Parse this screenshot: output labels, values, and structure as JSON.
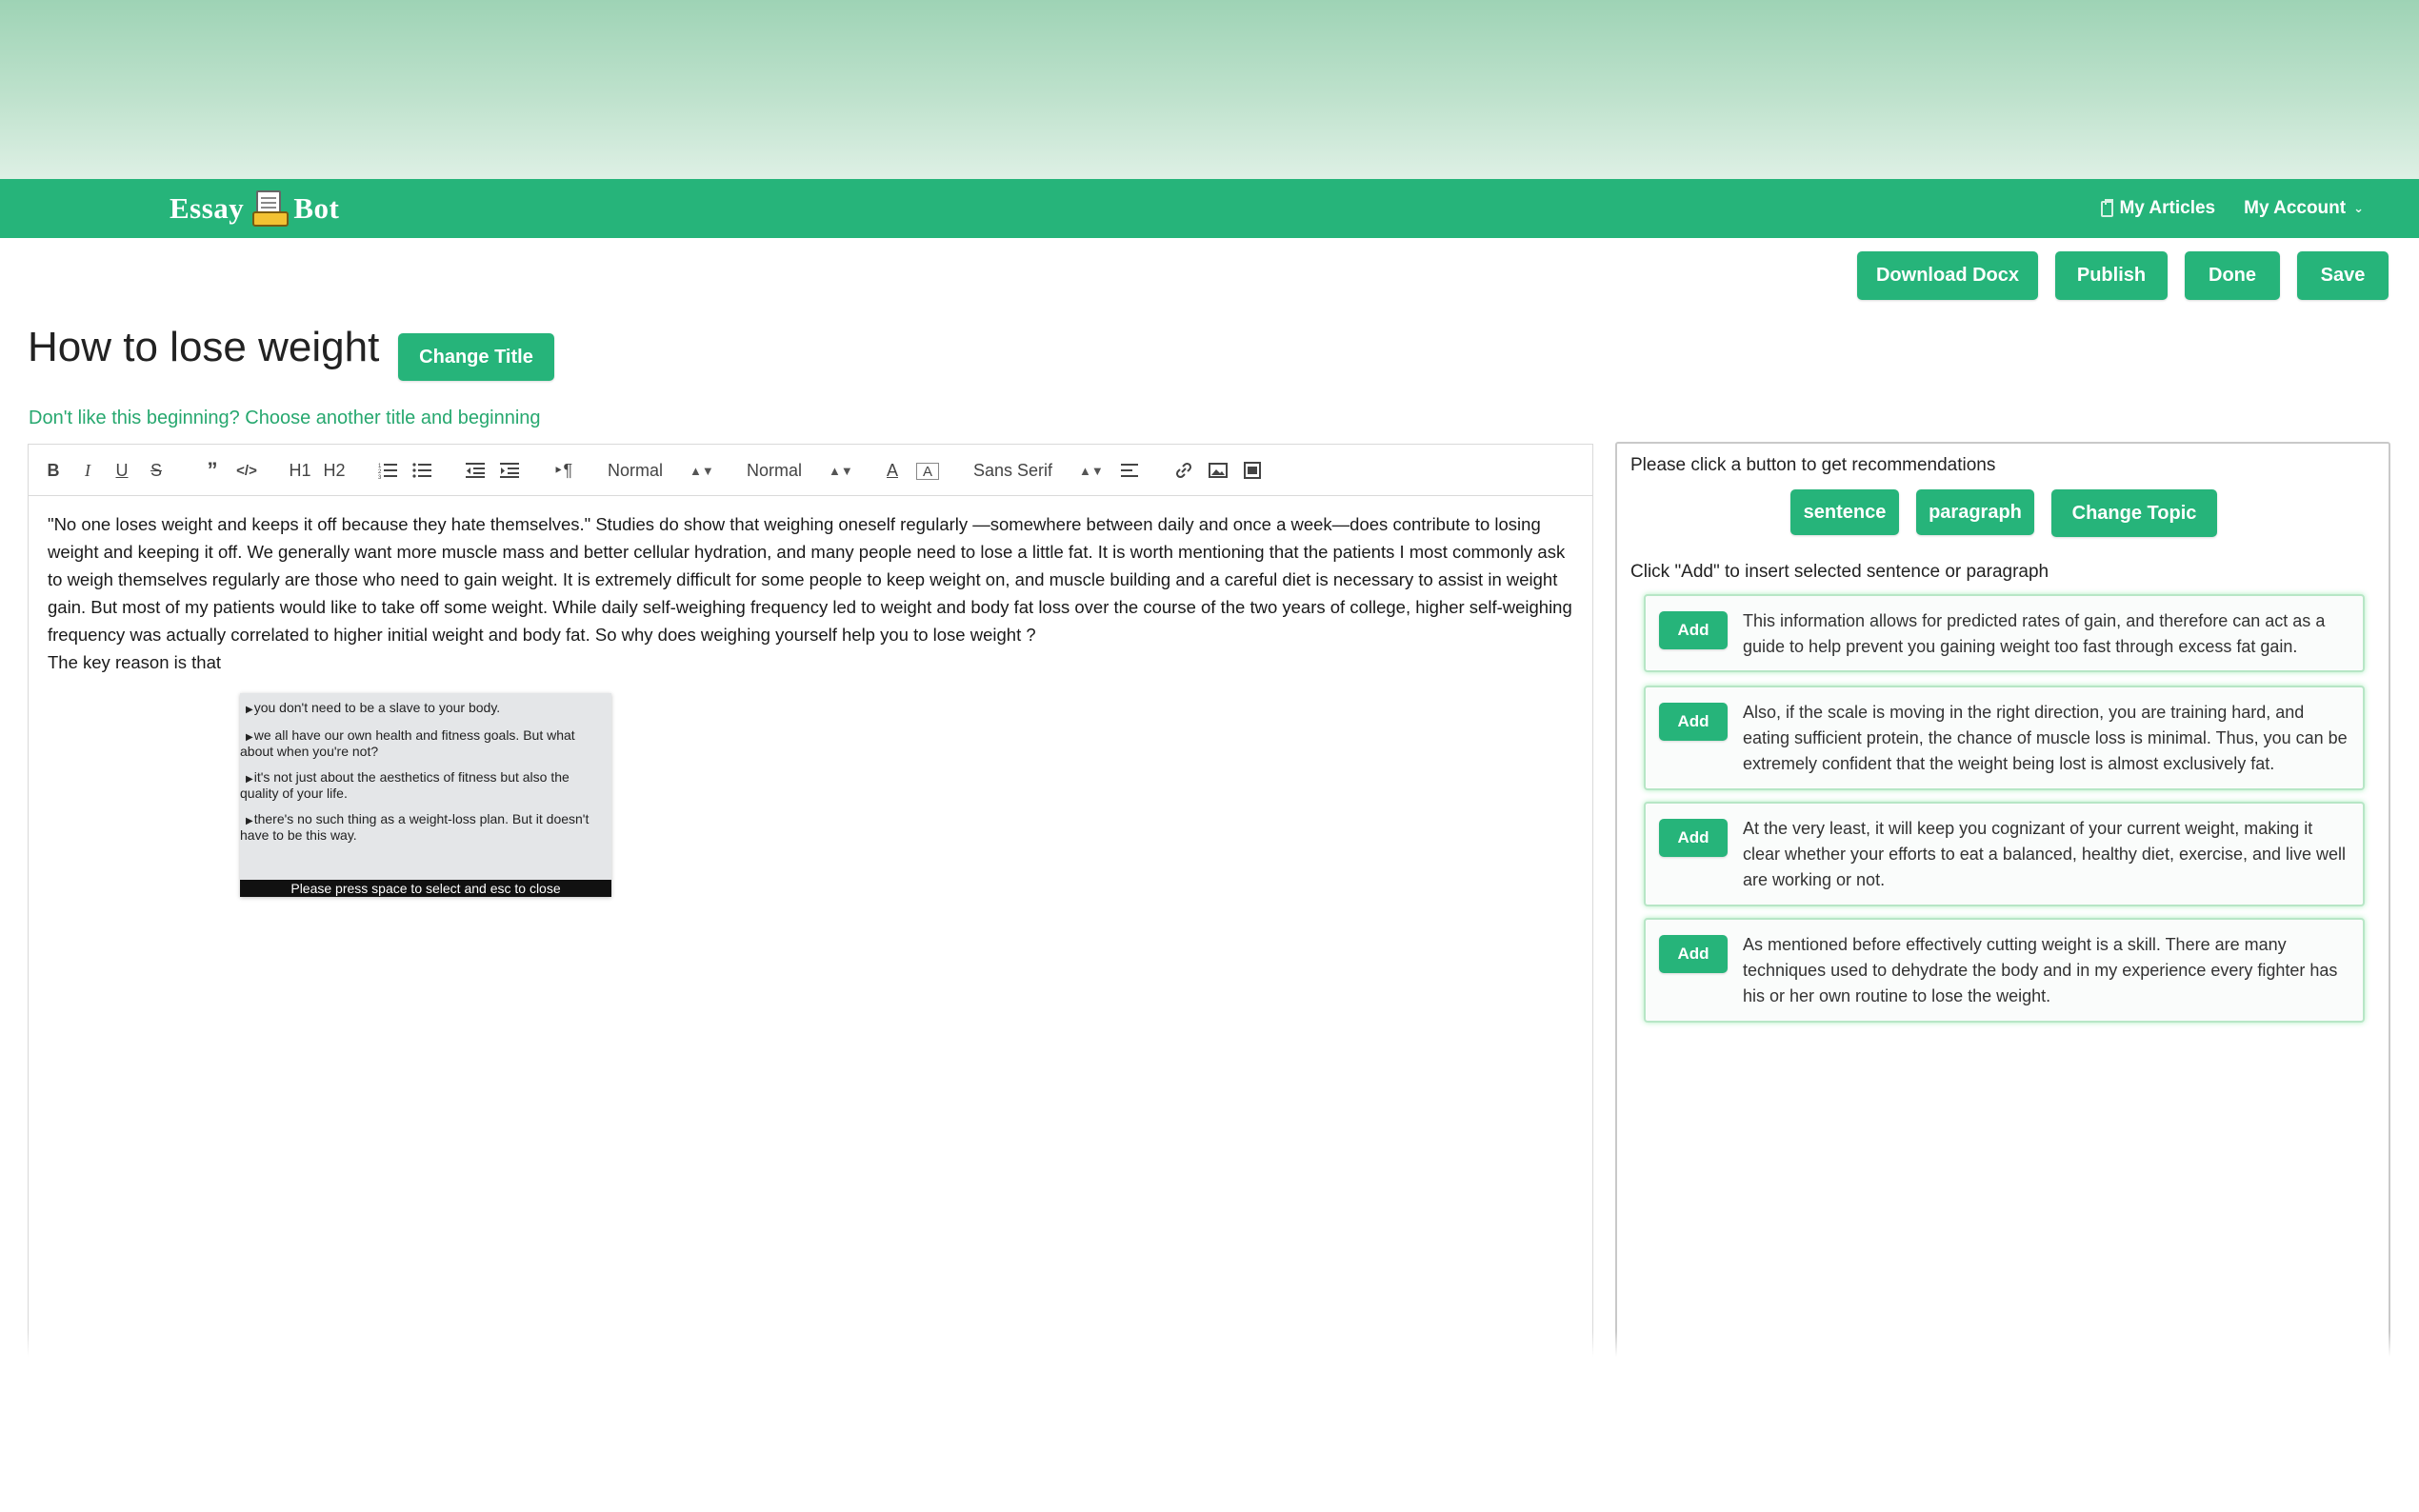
{
  "brand": {
    "left": "Essay",
    "right": "Bot"
  },
  "nav": {
    "my_articles": "My Articles",
    "my_account": "My Account"
  },
  "actions": {
    "download": "Download Docx",
    "publish": "Publish",
    "done": "Done",
    "save": "Save"
  },
  "title": {
    "text": "How to lose weight",
    "change_title": "Change Title"
  },
  "beginning_link": "Don't like this beginning? Choose another title and beginning",
  "toolbar": {
    "header_select": "Normal",
    "size_select": "Normal",
    "font_select": "Sans Serif",
    "h1": "H1",
    "h2": "H2"
  },
  "editor": {
    "paragraph": "\"No one loses weight and keeps it off because they hate themselves.\" Studies do show that weighing oneself regularly —somewhere between daily and once a week—does contribute to losing weight and keeping it off. We generally want more muscle mass and better cellular hydration, and many people need to lose a little fat. It is worth mentioning that the patients I most commonly ask to weigh themselves regularly are those who need to gain weight. It is extremely difficult for some people to keep weight on, and muscle building and a careful diet is necessary to assist in weight gain. But most of my patients would like to take off some weight. While daily self-weighing frequency led to weight and body fat loss over the course of the two years of college, higher self-weighing frequency was actually correlated to higher initial weight and body fat. So why does weighing yourself help you to lose weight ?",
    "continuation": "The key reason is that"
  },
  "popup": {
    "items": [
      "you don't need to be a slave to your body.",
      "we all have our own health and fitness goals. But what about when you're not?",
      "it's not just about the aesthetics of fitness but also the quality of your life.",
      "there's no such thing as a weight-loss plan. But it doesn't have to be this way."
    ],
    "footer": "Please press space to select and esc to close"
  },
  "panel": {
    "hint": "Please click a button to get recommendations",
    "buttons": {
      "sentence": "sentence",
      "paragraph": "paragraph",
      "change_topic": "Change Topic"
    },
    "add_hint": "Click \"Add\" to insert selected sentence or paragraph",
    "add_label": "Add",
    "recommendations": [
      "This information allows for predicted rates of gain, and therefore can act as a guide to help prevent you gaining weight too fast through excess fat gain.",
      "Also, if the scale is moving in the right direction, you are training hard, and eating sufficient protein, the chance of muscle loss is minimal. Thus, you can be extremely confident that the weight being lost is almost exclusively fat.",
      "At the very least, it will keep you cognizant of your current weight, making it clear whether your efforts to eat a balanced, healthy diet, exercise, and live well are working or not.",
      "As mentioned before effectively cutting weight is a skill. There are many techniques used to dehydrate the body and in my experience every fighter has his or her own routine to lose the weight."
    ]
  },
  "colors": {
    "brand_green": "#26b47a",
    "link_green": "#27a86f"
  }
}
